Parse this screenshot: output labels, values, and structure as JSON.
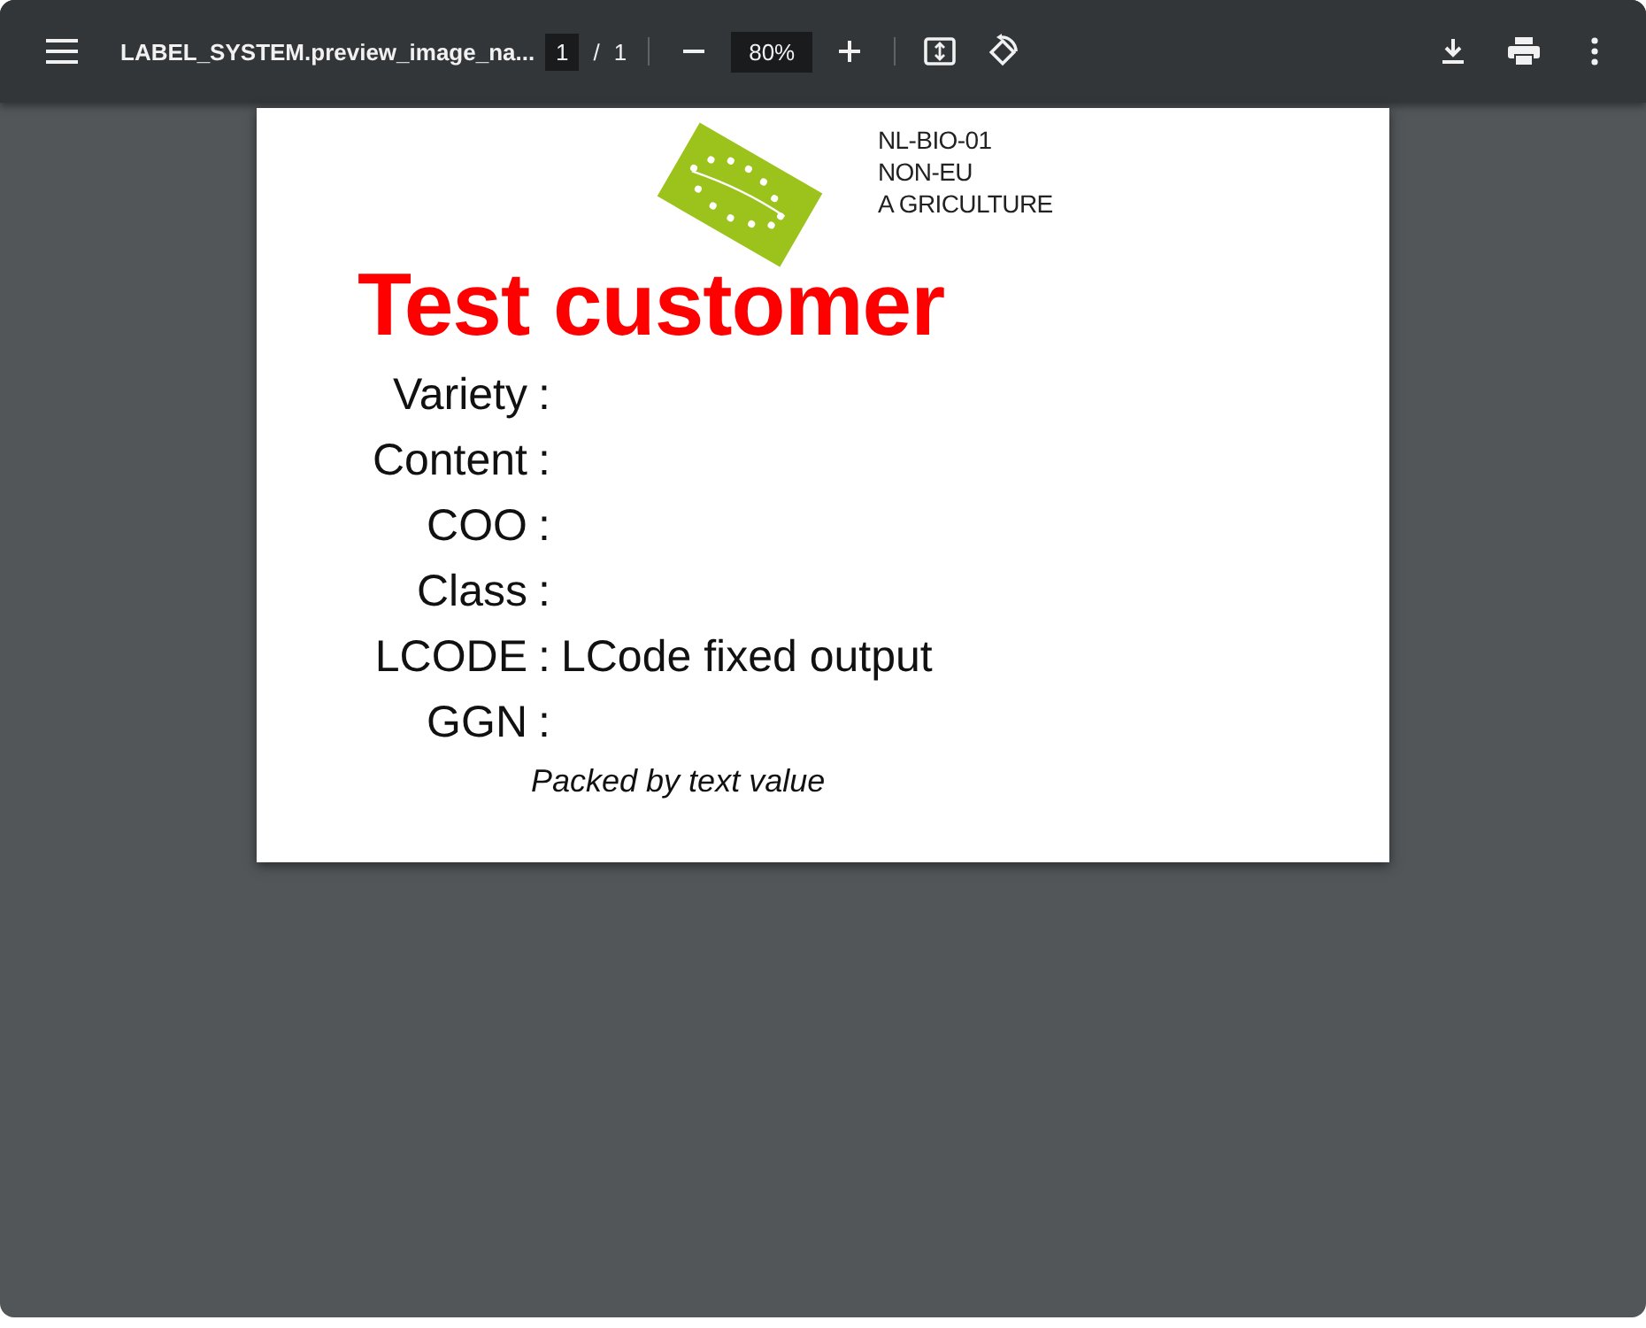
{
  "toolbar": {
    "file_name": "LABEL_SYSTEM.preview_image_na...",
    "page_current": "1",
    "page_separator": "/",
    "page_total": "1",
    "zoom": "80%"
  },
  "label": {
    "certification": [
      "NL-BIO-01",
      "NON-EU",
      "A GRICULTURE"
    ],
    "title": "Test customer",
    "rows": [
      {
        "label": "Variety",
        "separator": ":"
      },
      {
        "label": "Content",
        "separator": ":"
      },
      {
        "label": "COO",
        "separator": ":"
      },
      {
        "label": "Class",
        "separator": ":"
      },
      {
        "label": "LCODE",
        "separator": ":",
        "value": "LCode fixed output"
      },
      {
        "label": "GGN",
        "separator": ":"
      }
    ],
    "footer": "Packed by text value"
  }
}
